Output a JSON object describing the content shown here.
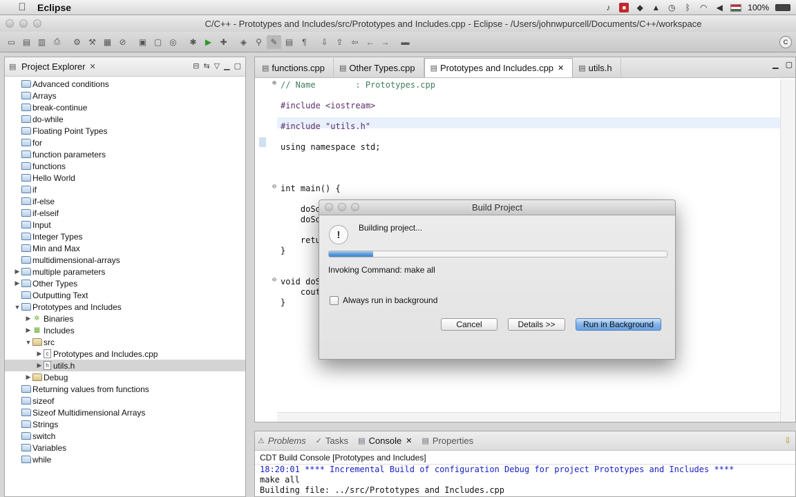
{
  "menubar": {
    "app_name": "Eclipse",
    "battery": "100%"
  },
  "window": {
    "title": "C/C++ - Prototypes and Includes/src/Prototypes and Includes.cpp - Eclipse - /Users/johnwpurcell/Documents/C++/workspace"
  },
  "explorer": {
    "title": "Project Explorer",
    "items": [
      {
        "label": "Advanced conditions",
        "depth": 0,
        "arrow": "",
        "icon": "folder"
      },
      {
        "label": "Arrays",
        "depth": 0,
        "arrow": "",
        "icon": "folder"
      },
      {
        "label": "break-continue",
        "depth": 0,
        "arrow": "",
        "icon": "folder"
      },
      {
        "label": "do-while",
        "depth": 0,
        "arrow": "",
        "icon": "folder"
      },
      {
        "label": "Floating Point Types",
        "depth": 0,
        "arrow": "",
        "icon": "folder"
      },
      {
        "label": "for",
        "depth": 0,
        "arrow": "",
        "icon": "folder"
      },
      {
        "label": "function parameters",
        "depth": 0,
        "arrow": "",
        "icon": "folder"
      },
      {
        "label": "functions",
        "depth": 0,
        "arrow": "",
        "icon": "folder"
      },
      {
        "label": "Hello World",
        "depth": 0,
        "arrow": "",
        "icon": "folder"
      },
      {
        "label": "if",
        "depth": 0,
        "arrow": "",
        "icon": "folder"
      },
      {
        "label": "if-else",
        "depth": 0,
        "arrow": "",
        "icon": "folder"
      },
      {
        "label": "if-elseif",
        "depth": 0,
        "arrow": "",
        "icon": "folder"
      },
      {
        "label": "Input",
        "depth": 0,
        "arrow": "",
        "icon": "folder"
      },
      {
        "label": "Integer Types",
        "depth": 0,
        "arrow": "",
        "icon": "folder"
      },
      {
        "label": "Min and Max",
        "depth": 0,
        "arrow": "",
        "icon": "folder"
      },
      {
        "label": "multidimensional-arrays",
        "depth": 0,
        "arrow": "",
        "icon": "folder"
      },
      {
        "label": "multiple parameters",
        "depth": 0,
        "arrow": "▶",
        "icon": "folder-open"
      },
      {
        "label": "Other Types",
        "depth": 0,
        "arrow": "▶",
        "icon": "folder-open"
      },
      {
        "label": "Outputting Text",
        "depth": 0,
        "arrow": "",
        "icon": "folder"
      },
      {
        "label": "Prototypes and Includes",
        "depth": 0,
        "arrow": "▼",
        "icon": "folder-open"
      },
      {
        "label": "Binaries",
        "depth": 1,
        "arrow": "▶",
        "icon": "binaries"
      },
      {
        "label": "Includes",
        "depth": 1,
        "arrow": "▶",
        "icon": "includes"
      },
      {
        "label": "src",
        "depth": 1,
        "arrow": "▼",
        "icon": "folder-open"
      },
      {
        "label": "Prototypes and Includes.cpp",
        "depth": 2,
        "arrow": "▶",
        "icon": "cpp-file"
      },
      {
        "label": "utils.h",
        "depth": 2,
        "arrow": "▶",
        "icon": "h-file",
        "selected": true
      },
      {
        "label": "Debug",
        "depth": 1,
        "arrow": "▶",
        "icon": "folder-open"
      },
      {
        "label": "Returning values from functions",
        "depth": 0,
        "arrow": "",
        "icon": "folder"
      },
      {
        "label": "sizeof",
        "depth": 0,
        "arrow": "",
        "icon": "folder"
      },
      {
        "label": "Sizeof Multidimensional Arrays",
        "depth": 0,
        "arrow": "",
        "icon": "folder"
      },
      {
        "label": "Strings",
        "depth": 0,
        "arrow": "",
        "icon": "folder"
      },
      {
        "label": "switch",
        "depth": 0,
        "arrow": "",
        "icon": "folder"
      },
      {
        "label": "Variables",
        "depth": 0,
        "arrow": "",
        "icon": "folder"
      },
      {
        "label": "while",
        "depth": 0,
        "arrow": "",
        "icon": "folder"
      }
    ]
  },
  "editor": {
    "tabs": [
      {
        "label": "functions.cpp",
        "active": false
      },
      {
        "label": "Other Types.cpp",
        "active": false
      },
      {
        "label": "Prototypes and Includes.cpp",
        "active": true
      },
      {
        "label": "utils.h",
        "active": false
      }
    ],
    "lines": {
      "l1": "// Name        : Prototypes.cpp",
      "l2": "#include <iostream>",
      "l3": "#include \"utils.h\"",
      "l4": "using namespace std;",
      "l5": "int main() {",
      "l6": "    doSo",
      "l7": "    doSo",
      "l8": "    retu",
      "l9": "}",
      "l10": "void doS",
      "l11": "    cout",
      "l12": "}"
    }
  },
  "console": {
    "tabs": {
      "problems": "Problems",
      "tasks": "Tasks",
      "console": "Console",
      "properties": "Properties"
    },
    "title": "CDT Build Console [Prototypes and Includes]",
    "lines": [
      {
        "text": "18:20:01 **** Incremental Build of configuration Debug for project Prototypes and Includes ****",
        "blue": true
      },
      {
        "text": "make all",
        "blue": false
      },
      {
        "text": "Building file: ../src/Prototypes and Includes.cpp",
        "blue": false
      }
    ]
  },
  "dialog": {
    "title": "Build Project",
    "message": "Building project...",
    "status": "Invoking Command: make all",
    "progress": 0.13,
    "checkbox_label": "Always run in background",
    "checked": false,
    "cancel_label": "Cancel",
    "details_label": "Details >>",
    "run_bg_label": "Run in Background"
  }
}
